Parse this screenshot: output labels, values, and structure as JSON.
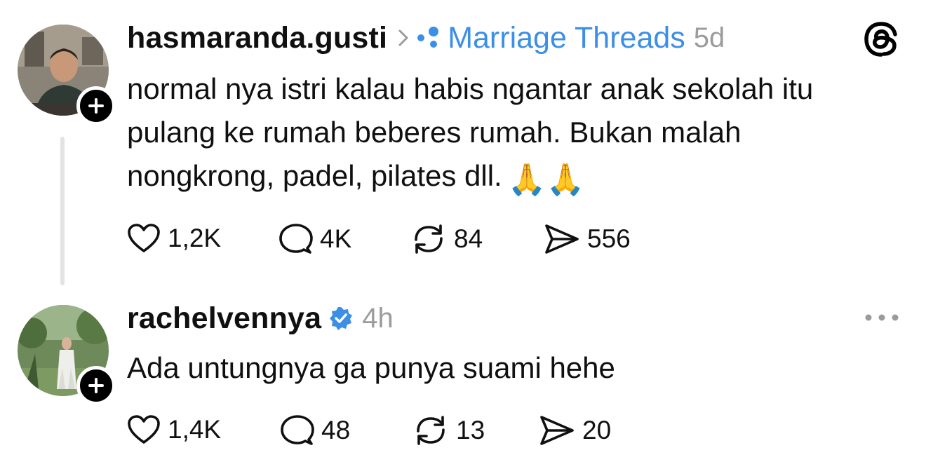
{
  "post": {
    "username": "hasmaranda.gusti",
    "community": "Marriage Threads",
    "time": "5d",
    "text_lines": [
      "normal nya istri kalau habis ngantar anak sekolah itu",
      "pulang ke rumah beberes rumah. Bukan malah",
      "nongkrong, padel, pilates dll."
    ],
    "emoji": "🙏🙏",
    "likes": "1,2K",
    "replies": "4K",
    "reposts": "84",
    "shares": "556"
  },
  "reply": {
    "username": "rachelvennya",
    "time": "4h",
    "text": "Ada untungnya ga punya suami hehe",
    "likes": "1,4K",
    "replies": "48",
    "reposts": "13",
    "shares": "20"
  },
  "icons": {
    "app_logo": "threads-logo-icon",
    "community": "community-icon",
    "verified": "verified-badge-icon",
    "like": "heart-icon",
    "reply": "comment-icon",
    "repost": "repost-icon",
    "share": "send-icon",
    "more": "more-options-icon",
    "follow": "plus-icon"
  },
  "colors": {
    "community": "#3b8fe6",
    "verified": "#3b8fe6",
    "muted": "#9b9b9b",
    "text": "#101010"
  }
}
